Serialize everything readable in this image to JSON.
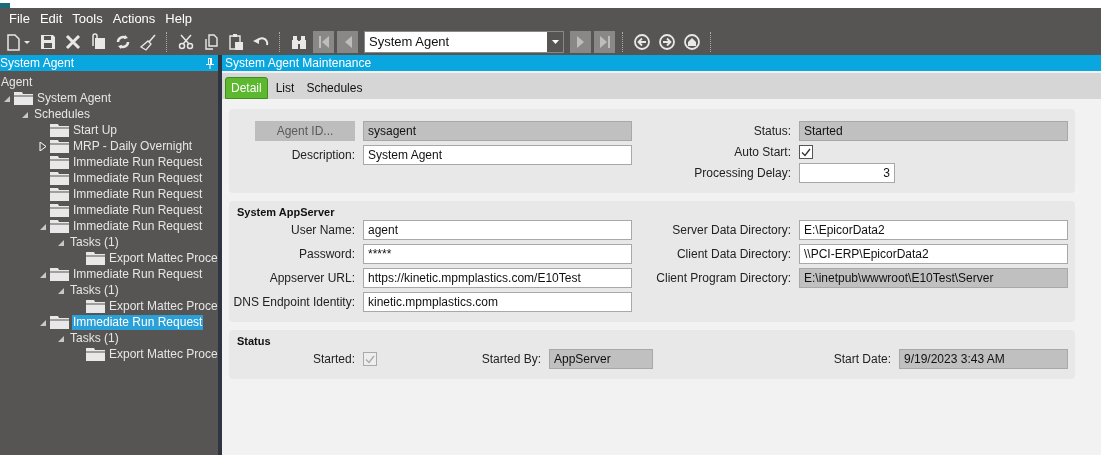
{
  "menu": [
    "File",
    "Edit",
    "Tools",
    "Actions",
    "Help"
  ],
  "toolbar": [
    {
      "kind": "new",
      "disabled": false
    },
    {
      "kind": "save",
      "disabled": false
    },
    {
      "kind": "delete",
      "disabled": false
    },
    {
      "kind": "attach",
      "disabled": false
    },
    {
      "kind": "refresh",
      "disabled": false
    },
    {
      "kind": "clear",
      "disabled": false
    },
    {
      "kind": "sep"
    },
    {
      "kind": "cut",
      "disabled": false
    },
    {
      "kind": "copy",
      "disabled": false
    },
    {
      "kind": "paste",
      "disabled": false
    },
    {
      "kind": "undo",
      "disabled": false
    },
    {
      "kind": "sep"
    },
    {
      "kind": "search",
      "disabled": false
    },
    {
      "kind": "first",
      "disabled": true
    },
    {
      "kind": "prev",
      "disabled": true
    },
    {
      "kind": "combo",
      "value": "System Agent"
    },
    {
      "kind": "next",
      "disabled": true
    },
    {
      "kind": "last",
      "disabled": true
    },
    {
      "kind": "sep"
    },
    {
      "kind": "back",
      "disabled": false
    },
    {
      "kind": "forward",
      "disabled": false
    },
    {
      "kind": "home",
      "disabled": false
    },
    {
      "kind": "sep"
    }
  ],
  "tree_panel": {
    "title": "System Agent",
    "items": [
      {
        "label": "Agent",
        "kind": "plain",
        "selected": false,
        "children": [
          {
            "label": "System Agent",
            "kind": "folder",
            "expanded": true,
            "selected": false,
            "children": [
              {
                "label": "Schedules",
                "kind": "plain",
                "expanded": true,
                "selected": false,
                "children": [
                  {
                    "label": "Start Up",
                    "kind": "folder",
                    "selected": false
                  },
                  {
                    "label": "MRP - Daily Overnight",
                    "kind": "folder",
                    "expanded": false,
                    "selected": false
                  },
                  {
                    "label": "Immediate Run Request",
                    "kind": "folder",
                    "selected": false
                  },
                  {
                    "label": "Immediate Run Request",
                    "kind": "folder",
                    "selected": false
                  },
                  {
                    "label": "Immediate Run Request",
                    "kind": "folder",
                    "selected": false
                  },
                  {
                    "label": "Immediate Run Request",
                    "kind": "folder",
                    "selected": false
                  },
                  {
                    "label": "Immediate Run Request",
                    "kind": "folder",
                    "expanded": true,
                    "selected": false,
                    "children": [
                      {
                        "label": "Tasks (1)",
                        "kind": "plain",
                        "expanded": true,
                        "selected": false,
                        "children": [
                          {
                            "label": "Export Mattec Proce",
                            "kind": "folder",
                            "selected": false
                          }
                        ]
                      }
                    ]
                  },
                  {
                    "label": "Immediate Run Request",
                    "kind": "folder",
                    "expanded": true,
                    "selected": false,
                    "children": [
                      {
                        "label": "Tasks (1)",
                        "kind": "plain",
                        "expanded": true,
                        "selected": false,
                        "children": [
                          {
                            "label": "Export Mattec Proce",
                            "kind": "folder",
                            "selected": false
                          }
                        ]
                      }
                    ]
                  },
                  {
                    "label": "Immediate Run Request",
                    "kind": "folder",
                    "expanded": true,
                    "selected": true,
                    "children": [
                      {
                        "label": "Tasks (1)",
                        "kind": "plain",
                        "expanded": true,
                        "selected": false,
                        "children": [
                          {
                            "label": "Export Mattec Proce",
                            "kind": "folder",
                            "selected": false
                          }
                        ]
                      }
                    ]
                  }
                ]
              }
            ]
          }
        ]
      }
    ]
  },
  "main": {
    "title": "System Agent Maintenance",
    "tabs": [
      {
        "label": "Detail",
        "selected": true
      },
      {
        "label": "List",
        "selected": false
      },
      {
        "label": "Schedules",
        "selected": false
      }
    ],
    "panels": [
      {
        "left": [
          {
            "kind": "lookup",
            "label": "Agent ID...",
            "value": "sysagent",
            "readonly": true
          },
          {
            "kind": "text",
            "label": "Description:",
            "value": "System Agent",
            "readonly": false
          }
        ],
        "right": [
          {
            "kind": "text",
            "label": "Status:",
            "value": "Started",
            "readonly": true
          },
          {
            "kind": "checkbox",
            "label": "Auto Start:",
            "checked": true
          },
          {
            "kind": "number",
            "label": "Processing Delay:",
            "value": "3",
            "readonly": false
          }
        ]
      },
      {
        "title": "System AppServer",
        "left": [
          {
            "kind": "text",
            "label": "User Name:",
            "value": "agent",
            "readonly": false
          },
          {
            "kind": "text",
            "label": "Password:",
            "value": "*****",
            "readonly": false
          },
          {
            "kind": "text",
            "label": "Appserver URL:",
            "value": "https://kinetic.mpmplastics.com/E10Test",
            "readonly": false
          },
          {
            "kind": "text",
            "label": "DNS Endpoint Identity:",
            "value": "kinetic.mpmplastics.com",
            "readonly": false
          }
        ],
        "right": [
          {
            "kind": "text",
            "label": "Server Data Directory:",
            "value": "E:\\EpicorData2",
            "readonly": false
          },
          {
            "kind": "text",
            "label": "Client Data Directory:",
            "value": "\\\\PCI-ERP\\EpicorData2",
            "readonly": false
          },
          {
            "kind": "text",
            "label": "Client Program Directory:",
            "value": "E:\\inetpub\\wwwroot\\E10Test\\Server",
            "readonly": true
          }
        ]
      }
    ],
    "status": {
      "title": "Status",
      "started": {
        "label": "Started:",
        "checked": true,
        "disabled": true
      },
      "started_by": {
        "label": "Started By:",
        "value": "AppServer",
        "readonly": true
      },
      "start_date": {
        "label": "Start Date:",
        "value": "9/19/2023 3:43 AM",
        "readonly": true
      }
    }
  }
}
